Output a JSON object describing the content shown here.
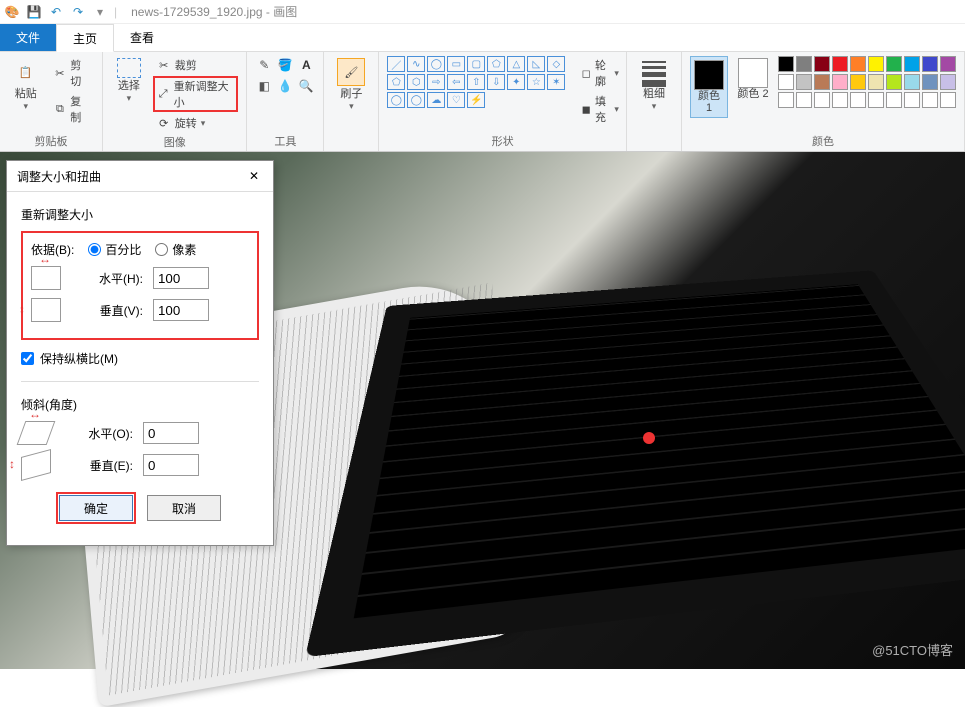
{
  "titlebar": {
    "filename": "news-1729539_1920.jpg",
    "app": "画图"
  },
  "tabs": {
    "file": "文件",
    "home": "主页",
    "view": "查看"
  },
  "ribbon": {
    "clipboard": {
      "paste": "粘贴",
      "cut": "剪切",
      "copy": "复制",
      "label": "剪贴板"
    },
    "image": {
      "select": "选择",
      "crop": "裁剪",
      "resize": "重新调整大小",
      "rotate": "旋转",
      "label": "图像"
    },
    "tools": {
      "label": "工具"
    },
    "brush": {
      "label": "刷子"
    },
    "shapes": {
      "outline": "轮廓",
      "fill": "填充",
      "label": "形状"
    },
    "size": {
      "label": "粗细"
    },
    "colors": {
      "color1": "颜色 1",
      "color2": "颜色 2",
      "label": "颜色"
    }
  },
  "dialog": {
    "title": "调整大小和扭曲",
    "resize_section": "重新调整大小",
    "by_label": "依据(B):",
    "by_percent": "百分比",
    "by_pixel": "像素",
    "horizontal": "水平(H):",
    "vertical": "垂直(V):",
    "h_value": "100",
    "v_value": "100",
    "maintain_aspect": "保持纵横比(M)",
    "skew_section": "倾斜(角度)",
    "skew_h": "水平(O):",
    "skew_v": "垂直(E):",
    "skew_h_value": "0",
    "skew_v_value": "0",
    "ok": "确定",
    "cancel": "取消"
  },
  "watermark": "@51CTO博客",
  "palette": [
    "#000000",
    "#7f7f7f",
    "#880015",
    "#ed1c24",
    "#ff7f27",
    "#fff200",
    "#22b14c",
    "#00a2e8",
    "#3f48cc",
    "#a349a4",
    "#ffffff",
    "#c3c3c3",
    "#b97a57",
    "#ffaec9",
    "#ffc90e",
    "#efe4b0",
    "#b5e61d",
    "#99d9ea",
    "#7092be",
    "#c8bfe7"
  ]
}
